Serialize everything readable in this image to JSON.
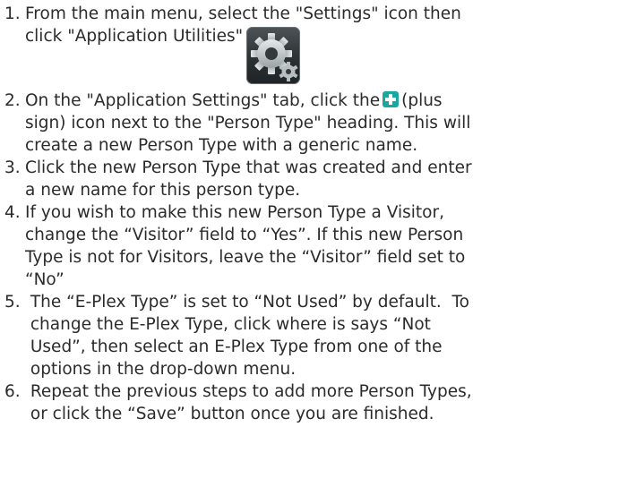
{
  "steps": [
    {
      "number": "1.",
      "lines": [
        "From the main menu, select the \"Settings\" icon then",
        "click \"Application Utilities\""
      ],
      "icon": "settings-gear-icon"
    },
    {
      "number": "2.",
      "line1_before": "On the \"Application Settings\" tab, click the",
      "line1_after": "(plus",
      "icon": "plus-icon",
      "lines_rest": [
        "sign) icon next to the \"Person Type\" heading. This will",
        "create a new Person Type with a generic name."
      ]
    },
    {
      "number": "3.",
      "lines": [
        "Click the new Person Type that was created and enter",
        "a new name for this person type."
      ]
    },
    {
      "number": "4.",
      "lines": [
        "If you wish to make this new Person Type a Visitor,",
        "change the “Visitor” field to “Yes”.  If this new Person",
        "Type is not for Visitors, leave the “Visitor” field set to",
        "“No”"
      ]
    },
    {
      "number": "5.",
      "lines": [
        " The “E-Plex Type” is set to “Not Used” by default.  To",
        " change the E-Plex Type, click where is says “Not",
        " Used”, then select an E-Plex Type from one of the",
        " options in the drop-down menu."
      ]
    },
    {
      "number": "6.",
      "lines": [
        " Repeat the previous steps to add more Person Types,",
        " or click the “Save” button once you are finished."
      ]
    }
  ],
  "colors": {
    "text": "#2b2b2b",
    "plus_icon_bg": "#1aa7a0",
    "gear_bg": "#34393c"
  }
}
